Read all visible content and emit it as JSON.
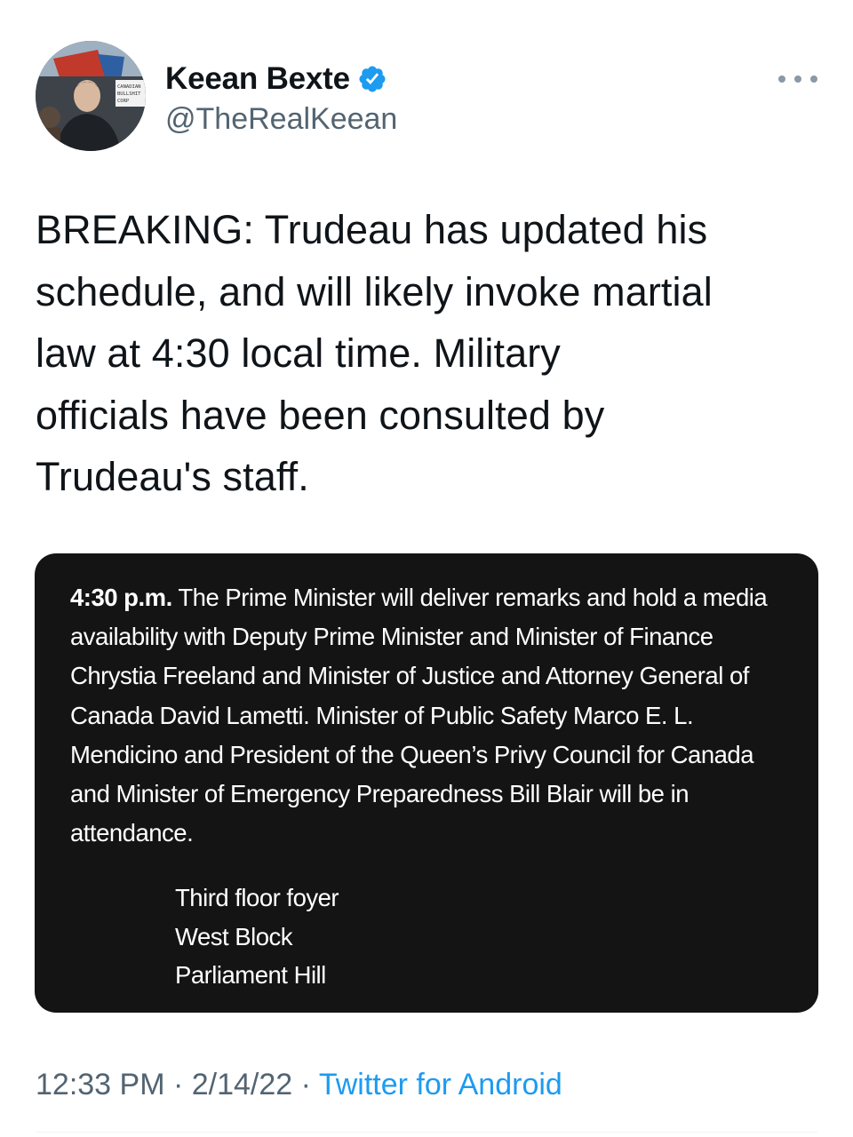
{
  "author": {
    "display_name": "Keean Bexte",
    "handle": "@TheRealKeean",
    "verified": true,
    "avatar_icon": "profile-photo",
    "avatar_sign_text": [
      "CANADIAN",
      "BULLSHIT",
      "CORP"
    ]
  },
  "tweet": {
    "text": "BREAKING: Trudeau has updated his\nschedule, and will likely invoke martial\nlaw at 4:30 local time. Military\nofficials have been consulted by\nTrudeau's staff."
  },
  "media": {
    "time_label": "4:30 p.m.",
    "paragraph": " The Prime Minister will deliver remarks and hold a media availability with Deputy Prime Minister and Minister of Finance Chrystia Freeland and Minister of Justice and Attorney General of Canada David Lametti. Minister of Public Safety Marco E. L. Mendicino and President of the Queen’s Privy Council for Canada and Minister of Emergency Preparedness Bill Blair will be in attendance.",
    "location": [
      "Third floor foyer",
      "West Block",
      "Parliament Hill"
    ]
  },
  "meta": {
    "time": "12:33 PM",
    "separator": " · ",
    "date": "2/14/22",
    "source": "Twitter for Android"
  },
  "colors": {
    "accent": "#1d9bf0",
    "secondary_text": "#536471",
    "media_background": "#141414"
  }
}
